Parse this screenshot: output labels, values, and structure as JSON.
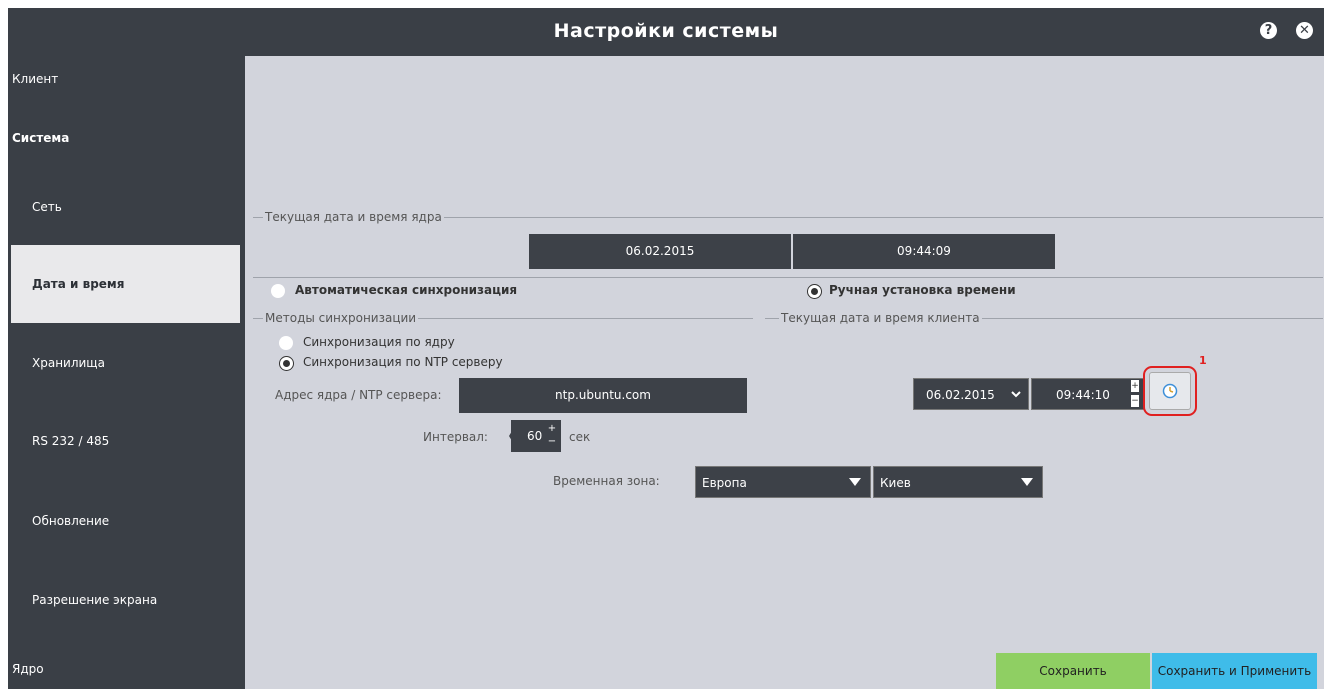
{
  "window": {
    "title": "Настройки системы",
    "help_icon": "help-icon",
    "close_icon": "close-icon"
  },
  "sidebar": {
    "items": [
      {
        "label": "Клиент"
      },
      {
        "label": "Система"
      },
      {
        "label": "Сеть"
      },
      {
        "label": "Дата и время"
      },
      {
        "label": "Хранилища"
      },
      {
        "label": "RS 232 / 485"
      },
      {
        "label": "Обновление"
      },
      {
        "label": "Разрешение экрана"
      },
      {
        "label": "Ядро"
      }
    ]
  },
  "core_time": {
    "legend": "Текущая дата и время ядра",
    "date": "06.02.2015",
    "time": "09:44:09"
  },
  "sync_mode": {
    "auto_label": "Автоматическая синхронизация",
    "manual_label": "Ручная установка времени",
    "selected": "manual"
  },
  "sync_methods": {
    "legend": "Методы синхронизации",
    "by_core_label": "Синхронизация по ядру",
    "by_ntp_label": "Синхронизация по NTP серверу",
    "selected": "ntp",
    "address_label": "Адрес ядра / NTP сервера:",
    "address_value": "ntp.ubuntu.com",
    "interval_label": "Интервал:",
    "interval_value": "60",
    "interval_unit": "сек"
  },
  "client_time": {
    "legend": "Текущая дата и время клиента",
    "date": "06.02.2015",
    "time": "09:44:10",
    "annotation": "1"
  },
  "timezone": {
    "label": "Временная зона:",
    "region": "Европа",
    "city": "Киев"
  },
  "buttons": {
    "save": "Сохранить",
    "save_apply": "Сохранить и Применить"
  },
  "colors": {
    "dark": "#3a3f46",
    "panel": "#d2d4dc",
    "save_green": "#8fcf63",
    "apply_blue": "#3fbce9",
    "annotation_red": "#e02020"
  }
}
